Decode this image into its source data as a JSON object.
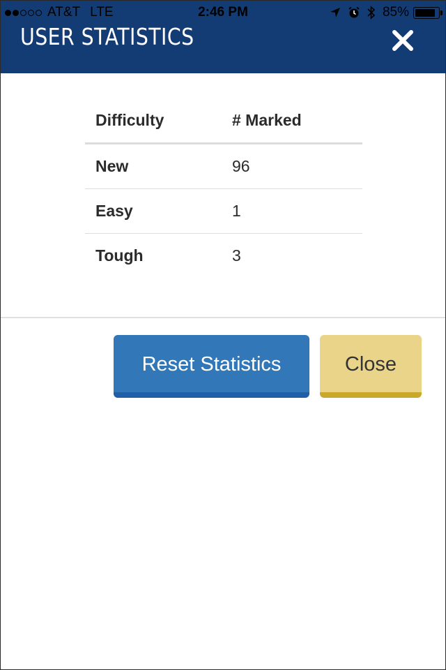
{
  "status_bar": {
    "carrier": "AT&T",
    "network": "LTE",
    "time": "2:46 PM",
    "battery": "85%",
    "signal_bars_filled": 2,
    "signal_bars_total": 5
  },
  "header": {
    "title": "USER STATISTICS",
    "close_icon": "close-x-icon"
  },
  "table": {
    "columns": [
      "Difficulty",
      "# Marked"
    ],
    "rows": [
      {
        "label": "New",
        "value": "96"
      },
      {
        "label": "Easy",
        "value": "1"
      },
      {
        "label": "Tough",
        "value": "3"
      }
    ]
  },
  "buttons": {
    "reset_label": "Reset Statistics",
    "close_label": "Close"
  },
  "colors": {
    "header_bg": "#143c74",
    "reset_button": "#3278b8",
    "close_button": "#e9d48a"
  }
}
